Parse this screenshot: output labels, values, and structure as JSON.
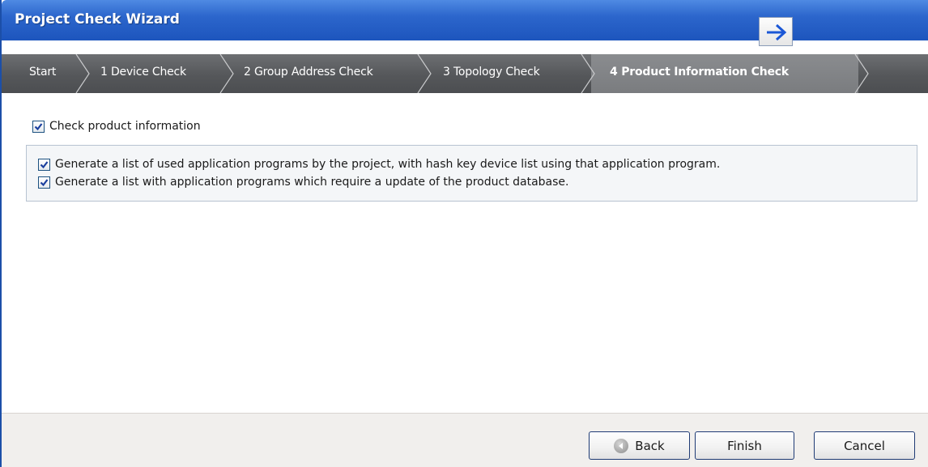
{
  "window": {
    "title": "Project Check Wizard"
  },
  "steps": [
    {
      "label": "Start"
    },
    {
      "label": "1 Device Check"
    },
    {
      "label": "2 Group Address Check"
    },
    {
      "label": "3 Topology Check"
    },
    {
      "label": "4 Product Information Check",
      "active": true
    }
  ],
  "options": {
    "check_product_information": {
      "label": "Check product information",
      "checked": true
    },
    "sub_options": [
      {
        "label": "Generate a list of used application programs by the project, with hash key device list using that application program.",
        "checked": true
      },
      {
        "label": "Generate a list with application programs which require a update of the product database.",
        "checked": true
      }
    ]
  },
  "buttons": {
    "back": "Back",
    "finish": "Finish",
    "cancel": "Cancel"
  },
  "icons": {
    "next_arrow": "arrow-right-icon",
    "back": "back-circle-icon"
  },
  "colors": {
    "title_bar": "#2c66cc",
    "step_bar": "#55575a",
    "active_step": "#7a7c7f",
    "footer": "#f1efed"
  }
}
